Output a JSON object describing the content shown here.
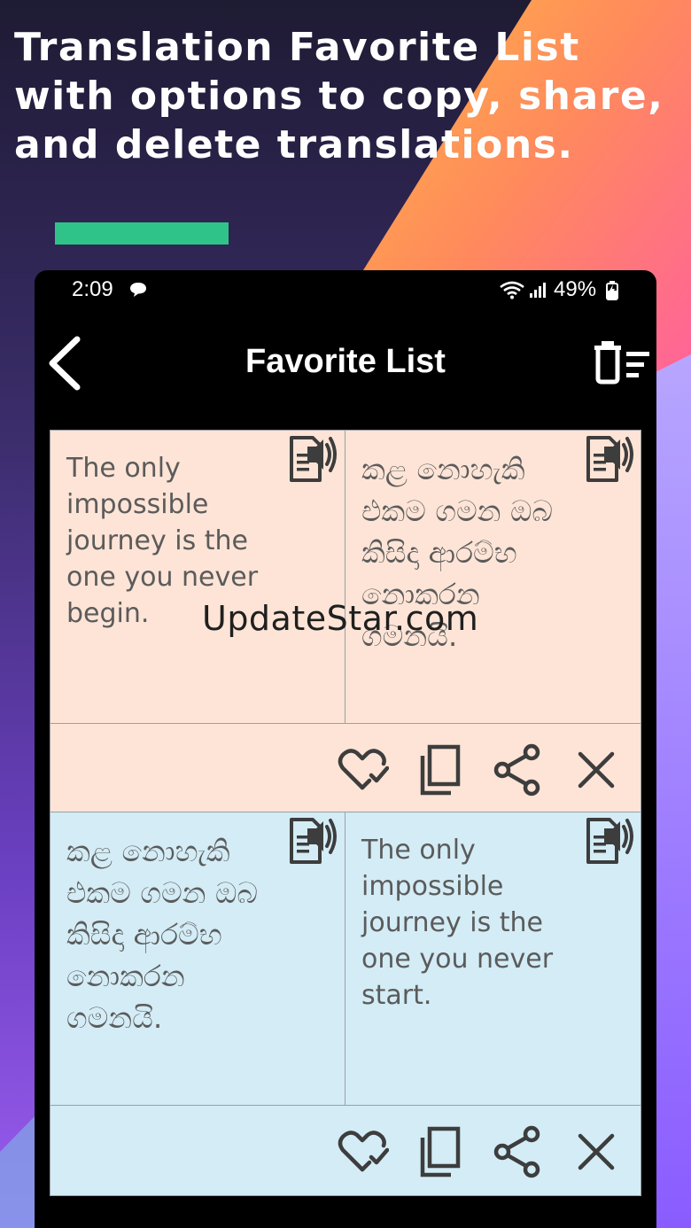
{
  "headline": {
    "line1": "Translation Favorite List",
    "line2": "with options to copy, share,",
    "line3": "and delete translations."
  },
  "colors": {
    "accent_bar": "#2fc38a",
    "card_source_bg": "#fde4d6",
    "card_target_bg": "#d3ecf6",
    "icon_color": "#3d3d3d"
  },
  "status_bar": {
    "time": "2:09",
    "battery": "49%",
    "icons": [
      "chat-bubble-icon",
      "wifi-icon",
      "signal-icon",
      "battery-charging-icon"
    ]
  },
  "app_bar": {
    "title": "Favorite List",
    "back_icon": "chevron-left-icon",
    "action_icon": "delete-list-icon"
  },
  "favorites": [
    {
      "left_text": "The only impossible journey is the one you never begin.",
      "right_text": "කළ නොහැකි එකම ගමන ඔබ කිසිදා ආරම්භ නොකරන ගමනයි.",
      "actions": [
        "heart-check-icon",
        "copy-icon",
        "share-icon",
        "close-icon"
      ]
    },
    {
      "left_text": "කළ නොහැකි එකම ගමන ඔබ කිසිදා ආරම්භ නොකරන ගමනයි.",
      "right_text": "The only impossible journey is the one you never start.",
      "actions": [
        "heart-check-icon",
        "copy-icon",
        "share-icon",
        "close-icon"
      ]
    }
  ],
  "watermark": "UpdateStar.com"
}
